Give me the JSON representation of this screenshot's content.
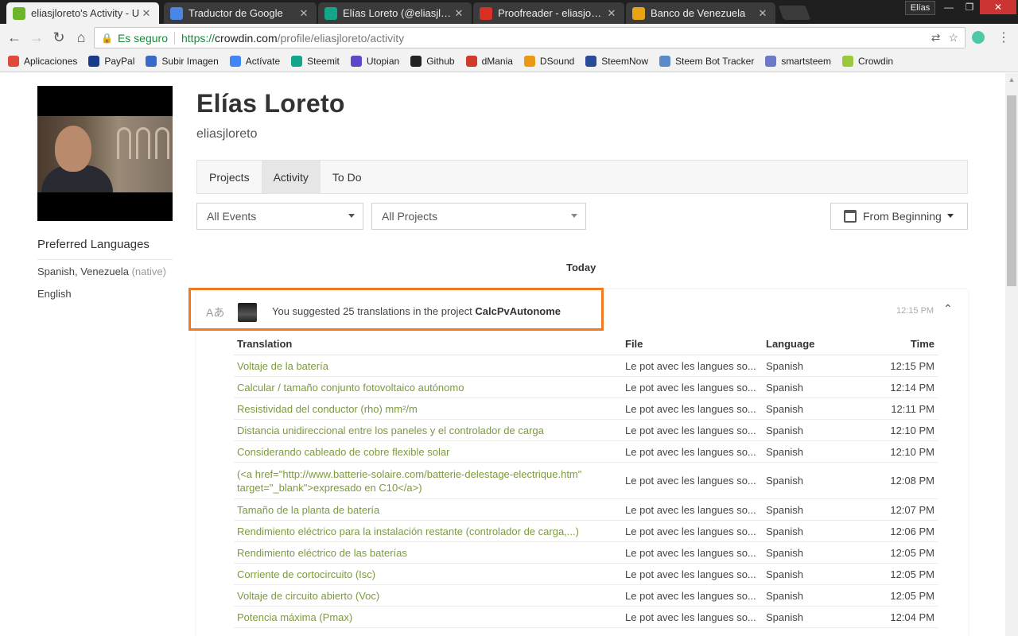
{
  "browser": {
    "tabs": [
      {
        "title": "eliasjloreto's Activity - U",
        "favicon_color": "#6bb52b",
        "active": true
      },
      {
        "title": "Traductor de Google",
        "favicon_color": "#4a86e8",
        "active": false
      },
      {
        "title": "Elías Loreto (@eliasjlore",
        "favicon_color": "#12a58a",
        "active": false
      },
      {
        "title": "Proofreader - eliasjoselo",
        "favicon_color": "#d93025",
        "active": false
      },
      {
        "title": "Banco de Venezuela",
        "favicon_color": "#e8a317",
        "active": false
      }
    ],
    "tab_close_glyph": "✕",
    "profile_name": "Elías",
    "window": {
      "minimize": "—",
      "maximize": "❐",
      "close": "✕"
    },
    "nav": {
      "back": "←",
      "forward": "→",
      "reload": "↻",
      "home": "⌂"
    },
    "address": {
      "lock": "🔒",
      "secure_label": "Es seguro",
      "scheme": "https://",
      "host": "crowdin.com",
      "path": "/profile/eliasjloreto/activity"
    },
    "omni_icons": {
      "translate": "⇄",
      "star": "☆"
    },
    "menu": "⋮",
    "bookmarks": [
      {
        "label": "Aplicaciones",
        "color": "#e04a3a"
      },
      {
        "label": "PayPal",
        "color": "#1a3a8a"
      },
      {
        "label": "Subir Imagen",
        "color": "#3a6ac8"
      },
      {
        "label": "Actívate",
        "color": "#4285f4"
      },
      {
        "label": "Steemit",
        "color": "#12a58a"
      },
      {
        "label": "Utopian",
        "color": "#5a4ac8"
      },
      {
        "label": "Github",
        "color": "#222222"
      },
      {
        "label": "dMania",
        "color": "#d03a2a"
      },
      {
        "label": "DSound",
        "color": "#e89a17"
      },
      {
        "label": "SteemNow",
        "color": "#2a4a9a"
      },
      {
        "label": "Steem Bot Tracker",
        "color": "#5a8ac8"
      },
      {
        "label": "smartsteem",
        "color": "#6a7ac8"
      },
      {
        "label": "Crowdin",
        "color": "#9ac83a"
      }
    ]
  },
  "profile": {
    "display_name": "Elías Loreto",
    "username": "eliasjloreto",
    "preferred_languages_title": "Preferred Languages",
    "languages": [
      {
        "name": "Spanish, Venezuela",
        "note": "(native)"
      },
      {
        "name": "English",
        "note": ""
      }
    ]
  },
  "profile_tabs": [
    {
      "label": "Projects",
      "active": false
    },
    {
      "label": "Activity",
      "active": true
    },
    {
      "label": "To Do",
      "active": false
    }
  ],
  "filters": {
    "events": "All Events",
    "projects": "All Projects",
    "date": "From Beginning"
  },
  "section_label": "Today",
  "activity": {
    "text_prefix": "You suggested 25 translations in the project ",
    "project": "CalcPvAutonome",
    "time": "12:15 PM",
    "collapse_glyph": "⌃",
    "language_icon": "Aあ",
    "highlight_color": "#f07a22"
  },
  "table": {
    "columns": [
      "Translation",
      "File",
      "Language",
      "Time"
    ],
    "rows": [
      {
        "translation": "Voltaje de la batería",
        "file": "Le pot avec les langues so...",
        "language": "Spanish",
        "time": "12:15 PM"
      },
      {
        "translation": "Calcular / tamaño conjunto fotovoltaico autónomo",
        "file": "Le pot avec les langues so...",
        "language": "Spanish",
        "time": "12:14 PM"
      },
      {
        "translation": "Resistividad del conductor (rho) mm²/m",
        "file": "Le pot avec les langues so...",
        "language": "Spanish",
        "time": "12:11 PM"
      },
      {
        "translation": "Distancia unidireccional entre los paneles y el controlador de carga",
        "file": "Le pot avec les langues so...",
        "language": "Spanish",
        "time": "12:10 PM"
      },
      {
        "translation": "Considerando cableado de cobre flexible solar",
        "file": "Le pot avec les langues so...",
        "language": "Spanish",
        "time": "12:10 PM"
      },
      {
        "translation": "(<a href=\"http://www.batterie-solaire.com/batterie-delestage-electrique.htm\" target=\"_blank\">expresado en C10</a>)",
        "file": "Le pot avec les langues so...",
        "language": "Spanish",
        "time": "12:08 PM"
      },
      {
        "translation": "Tamaño de la planta de batería",
        "file": "Le pot avec les langues so...",
        "language": "Spanish",
        "time": "12:07 PM"
      },
      {
        "translation": "Rendimiento eléctrico para la instalación restante (controlador de carga,...)",
        "file": "Le pot avec les langues so...",
        "language": "Spanish",
        "time": "12:06 PM"
      },
      {
        "translation": "Rendimiento eléctrico de las baterías",
        "file": "Le pot avec les langues so...",
        "language": "Spanish",
        "time": "12:05 PM"
      },
      {
        "translation": "Corriente de cortocircuito (Isc)",
        "file": "Le pot avec les langues so...",
        "language": "Spanish",
        "time": "12:05 PM"
      },
      {
        "translation": "Voltaje de circuito abierto (Voc)",
        "file": "Le pot avec les langues so...",
        "language": "Spanish",
        "time": "12:05 PM"
      },
      {
        "translation": "Potencia máxima (Pmax)",
        "file": "Le pot avec les langues so...",
        "language": "Spanish",
        "time": "12:04 PM"
      }
    ]
  }
}
